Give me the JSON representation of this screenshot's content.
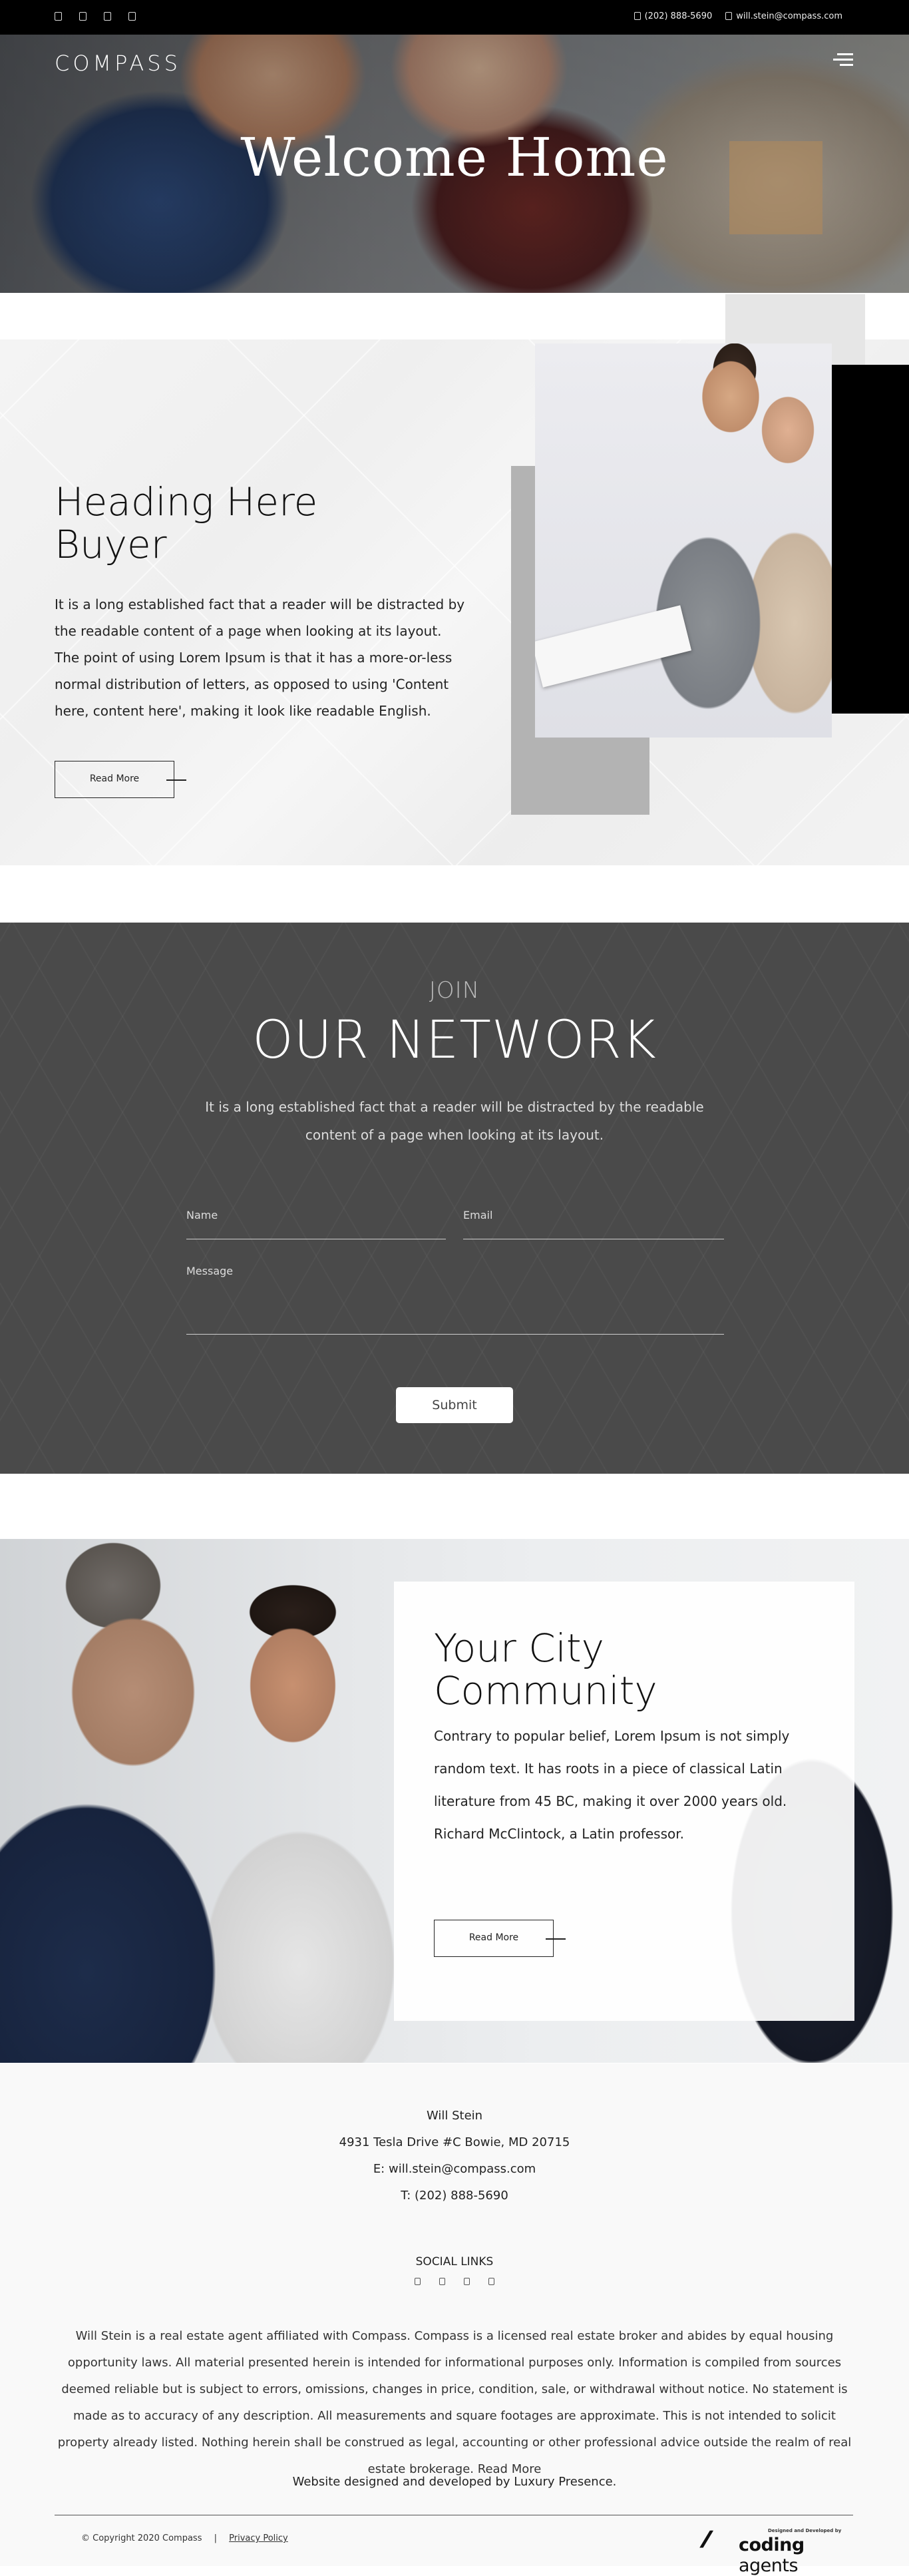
{
  "topbar": {
    "social_icons": [
      "social-icon-1",
      "social-icon-2",
      "social-icon-3",
      "social-icon-4"
    ],
    "phone": "(202) 888-5690",
    "email": "will.stein@compass.com"
  },
  "header": {
    "logo": "COMPASS",
    "menu_icon": "hamburger-icon"
  },
  "hero": {
    "title": "Welcome Home"
  },
  "buyer": {
    "title_line1": "Heading Here",
    "title_line2": "Buyer",
    "text": "It is a long established fact that a reader will be distracted by the readable content of a page when looking at its layout. The point of using Lorem Ipsum is that it has a more-or-less normal distribution of letters, as opposed to using 'Content here, content here', making it look like readable English.",
    "button": "Read More"
  },
  "network": {
    "subtitle": "JOIN",
    "title": "OUR NETWORK",
    "text": "It is a long established fact that a reader will be distracted by the readable content of a page when looking at its layout.",
    "name_label": "Name",
    "email_label": "Email",
    "message_label": "Message",
    "submit": "Submit"
  },
  "community": {
    "title_line1": "Your City",
    "title_line2": "Community",
    "text": "Contrary to popular belief, Lorem Ipsum is not simply random text. It has roots in a piece of classical Latin literature from 45 BC, making it over 2000 years old. Richard McClintock, a Latin professor.",
    "button": "Read More"
  },
  "footer": {
    "name": "Will Stein",
    "address": "4931 Tesla Drive #C Bowie, MD 20715",
    "email": "E: will.stein@compass.com",
    "phone": "T: (202) 888-5690",
    "social_heading": "SOCIAL LINKS",
    "social_icons": [
      "social-icon-1",
      "social-icon-2",
      "social-icon-3",
      "social-icon-4"
    ],
    "disclaimer": "Will Stein is a real estate agent affiliated with Compass. Compass is a licensed real estate broker and abides by equal housing opportunity laws. All material presented herein is intended for informational purposes only. Information is compiled from sources deemed reliable but is subject to errors, omissions, changes in price, condition, sale, or withdrawal without notice. No statement is made as to accuracy of any description. All measurements and square footages are approximate. This is not intended to solicit property already listed. Nothing herein shall be construed as legal, accounting or other professional advice outside the realm of real estate brokerage. Read More",
    "credits": "Website designed and developed by Luxury Presence.",
    "copyright": "© Copyright 2020 Compass",
    "separator": "|",
    "privacy": "Privacy Policy",
    "badge_small": "Designed and Developed by",
    "badge_name_bold": "coding",
    "badge_name_light": "agents"
  }
}
